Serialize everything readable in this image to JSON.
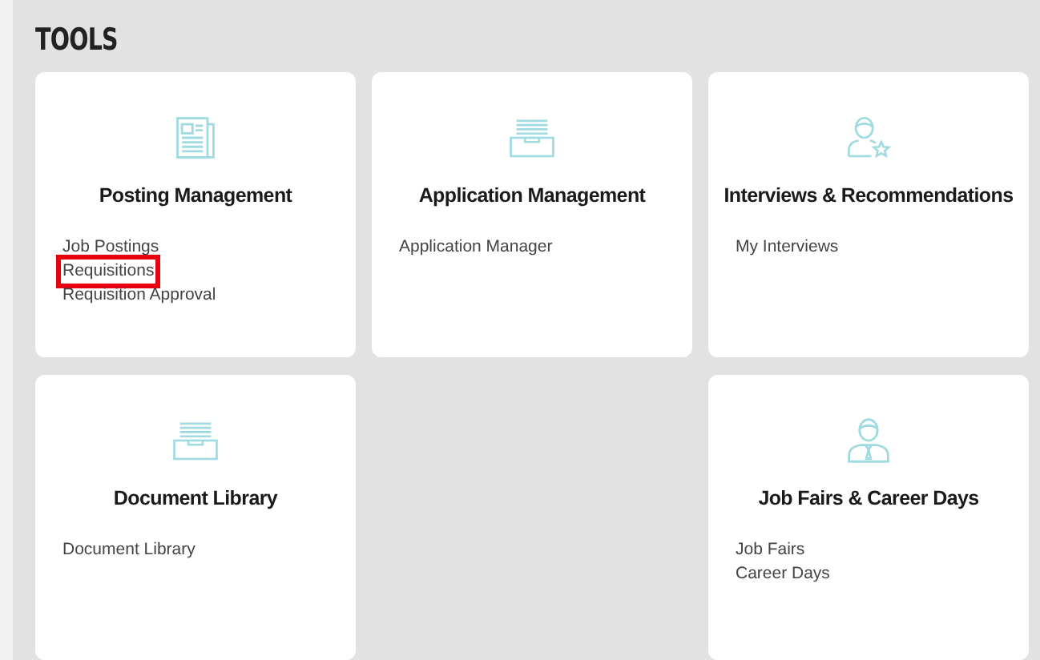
{
  "section_title": "TOOLS",
  "cards": [
    {
      "kind": "tool",
      "title": "Posting Management",
      "links": [
        {
          "label": "Job Postings",
          "highlighted": false
        },
        {
          "label": "Requisitions",
          "highlighted": true
        },
        {
          "label": "Requisition Approval",
          "highlighted": false
        }
      ]
    },
    {
      "kind": "tool",
      "title": "Application Management",
      "links": [
        {
          "label": "Application Manager",
          "highlighted": false
        }
      ]
    },
    {
      "kind": "tool",
      "title": "Interviews & Recommendations",
      "links": [
        {
          "label": "My Interviews",
          "highlighted": false
        }
      ]
    },
    {
      "kind": "tool",
      "title": "Document Library",
      "links": [
        {
          "label": "Document Library",
          "highlighted": false
        }
      ]
    },
    {
      "kind": "blank"
    },
    {
      "kind": "tool",
      "title": "Job Fairs & Career Days",
      "links": [
        {
          "label": "Job Fairs",
          "highlighted": false
        },
        {
          "label": "Career Days",
          "highlighted": false
        }
      ]
    }
  ]
}
